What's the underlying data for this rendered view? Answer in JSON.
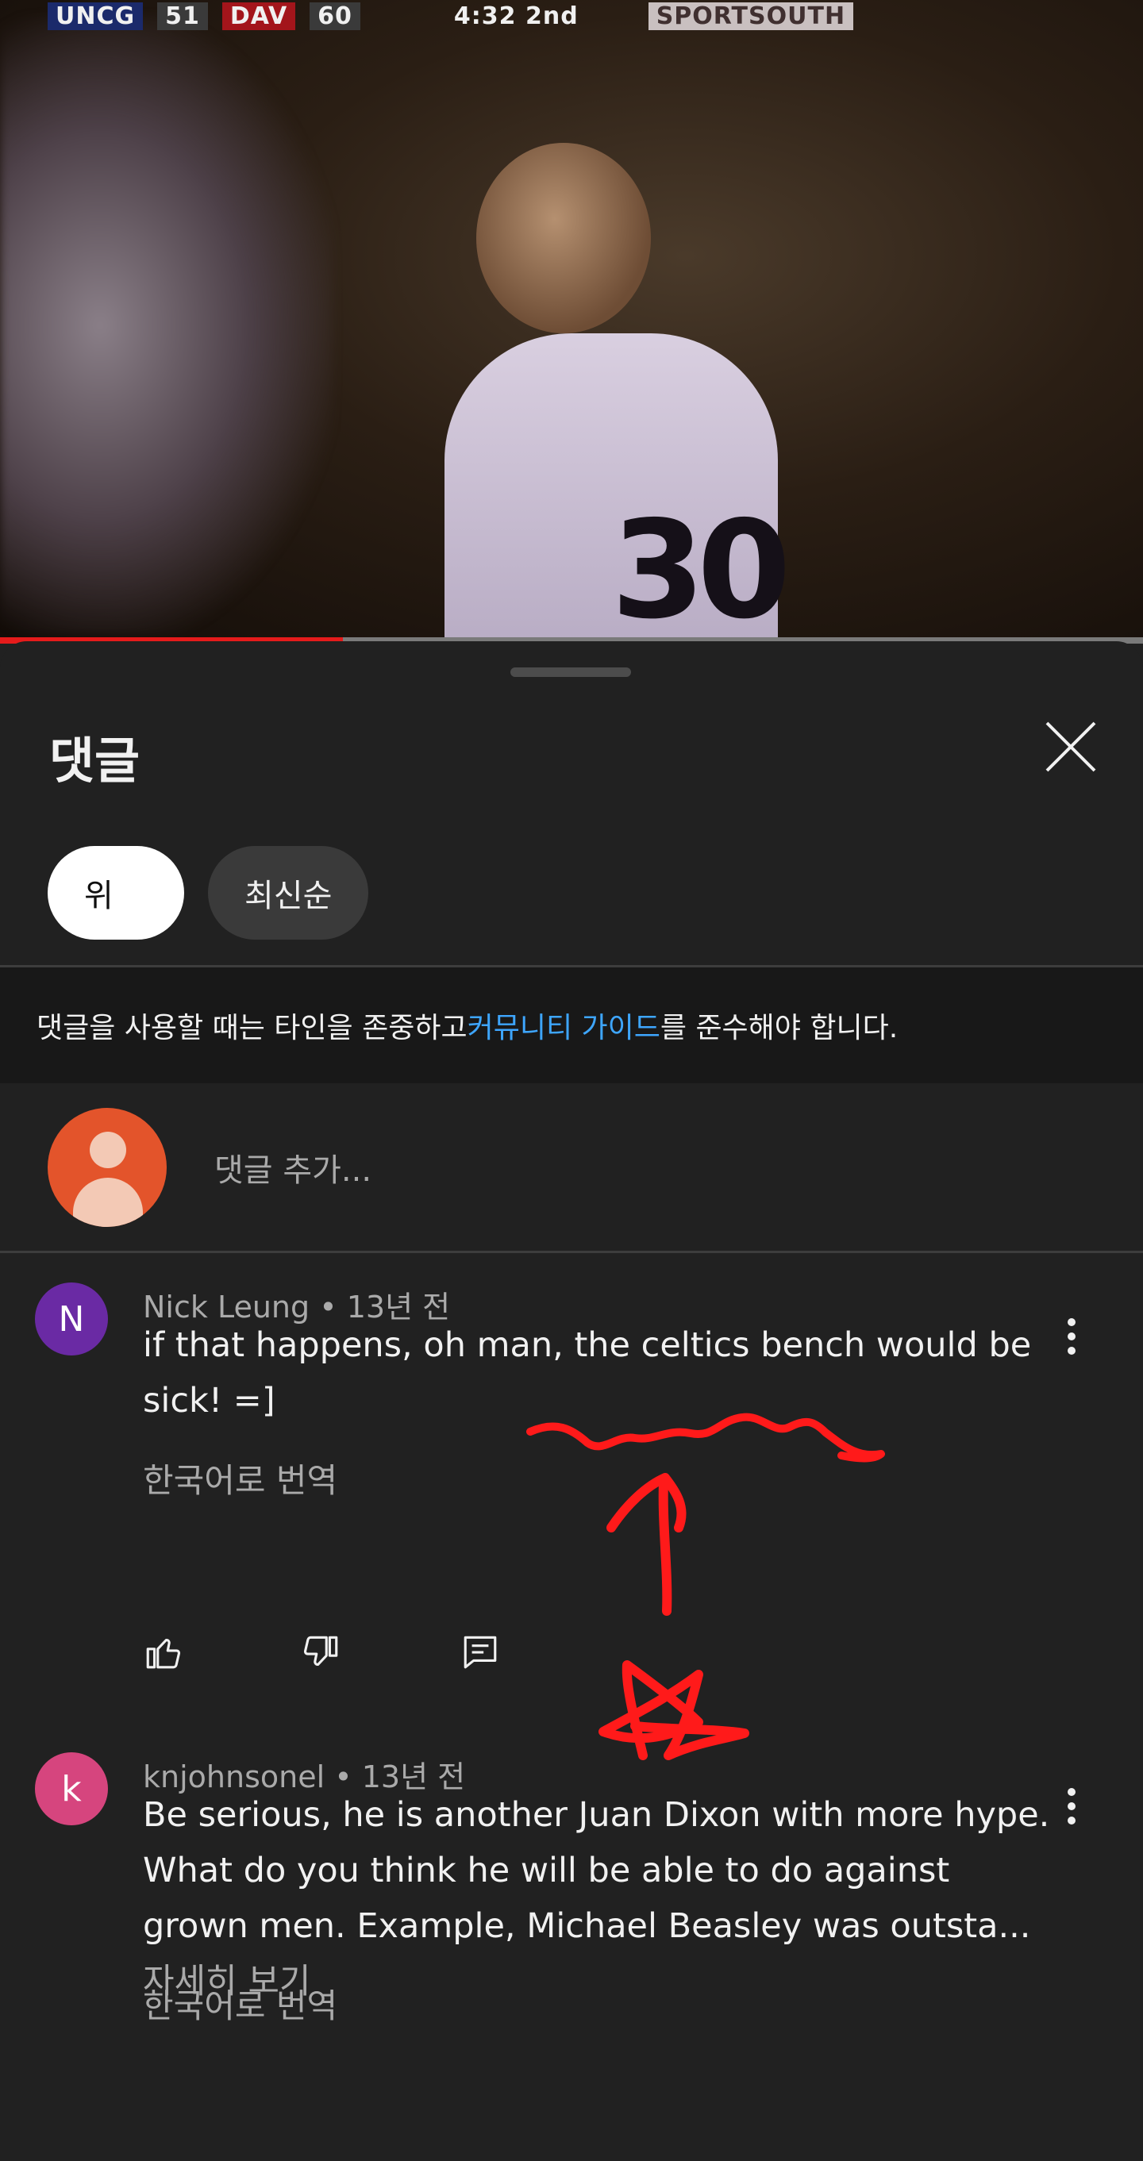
{
  "video": {
    "scoreboard": {
      "team1": "UNCG",
      "score1": "51",
      "team2": "DAV",
      "score2": "60",
      "clock": "4:32 2nd",
      "network": "SPORTSOUTH"
    },
    "jersey_number": "30",
    "progress": 0.3
  },
  "comments_panel": {
    "title": "댓글",
    "filters": [
      {
        "label": "위",
        "active": true
      },
      {
        "label": "최신순",
        "active": false
      }
    ],
    "guideline": {
      "before": "댓글을 사용할 때는 타인을 존중하고 ",
      "link": "커뮤니티 가이드",
      "after": "를 준수해야 합니다."
    },
    "add_placeholder": "댓글 추가...",
    "comments": [
      {
        "avatar_letter": "N",
        "avatar_color": "#6a2aa4",
        "author": "Nick Leung",
        "time": "13년 전",
        "text": "if that happens, oh man, the celtics bench would be sick! =]",
        "more": "",
        "translate": "한국어로 번역"
      },
      {
        "avatar_letter": "k",
        "avatar_color": "#d6457e",
        "author": "knjohnsonel",
        "time": "13년 전",
        "text": "Be serious, he is another Juan Dixon with more hype. What do you think he will be able to do against grown men. Example, Michael Beasley was outsta...",
        "more": " 자세히 보기",
        "translate": "한국어로 번역"
      }
    ]
  },
  "colors": {
    "background": "#212121",
    "accent_link": "#3ea6ff",
    "progress": "#e51b1b",
    "annotation": "#ff1a1a"
  }
}
